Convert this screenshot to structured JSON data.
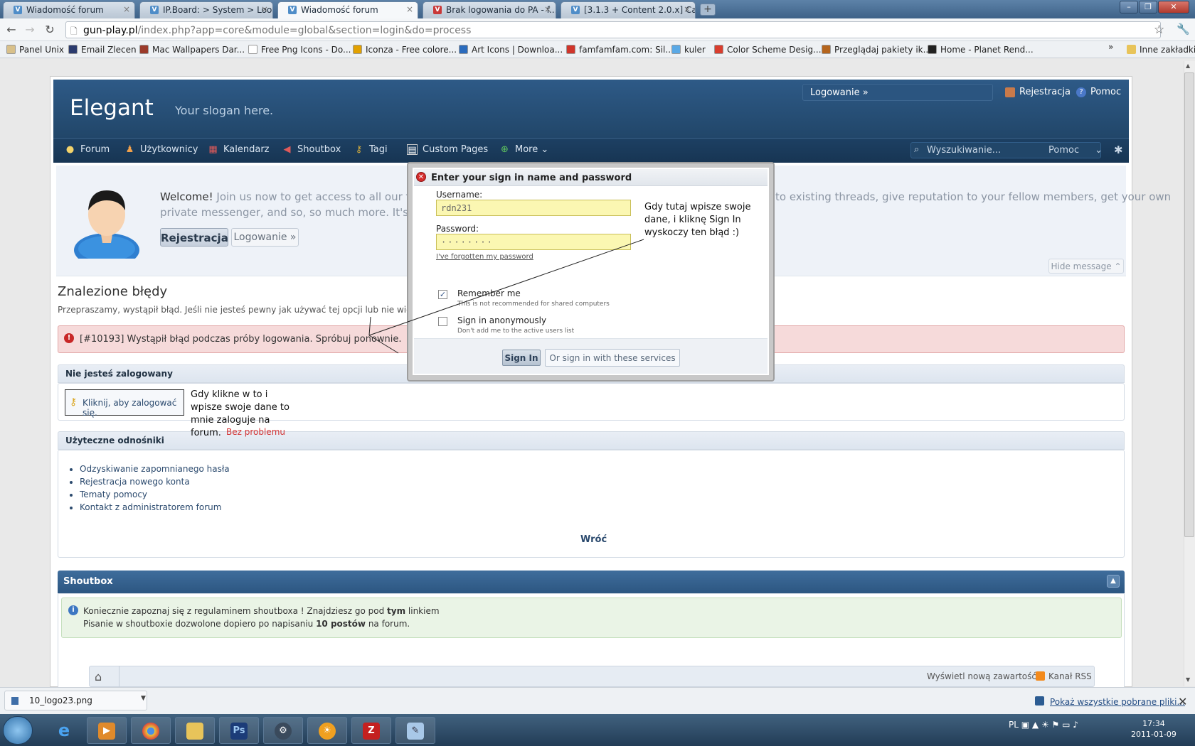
{
  "browser": {
    "tabs": [
      {
        "label": "Wiadomość forum"
      },
      {
        "label": "IP.Board: > System > Loo..."
      },
      {
        "label": "Wiadomość forum"
      },
      {
        "label": "Brak logowania do PA - f..."
      },
      {
        "label": "[3.1.3 + Content 2.0.x] Ca..."
      }
    ],
    "new_tab": "+",
    "url_domain": "gun-play.pl",
    "url_path": "/index.php?app=core&module=global&section=login&do=process",
    "bookmarks": [
      {
        "label": "Panel Unix",
        "color": "#d8c08a"
      },
      {
        "label": "Email Zlecen",
        "color": "#2b3b6e"
      },
      {
        "label": "Mac Wallpapers Dar...",
        "color": "#9b3b2b"
      },
      {
        "label": "Free Png Icons - Do...",
        "color": "#ffffff"
      },
      {
        "label": "Iconza - Free colore...",
        "color": "#e2a100"
      },
      {
        "label": "Art Icons | Downloa...",
        "color": "#2a6bbd"
      },
      {
        "label": "famfamfam.com: Sil...",
        "color": "#d0352b"
      },
      {
        "label": "kuler",
        "color": "#5aa9e6"
      },
      {
        "label": "Color Scheme Desig...",
        "color": "#d93d2e"
      },
      {
        "label": "Przeglądaj pakiety ik...",
        "color": "#b5651d"
      },
      {
        "label": "Home - Planet Rend...",
        "color": "#222222"
      }
    ],
    "other_bookmarks": "Inne zakładki"
  },
  "site": {
    "logo": "Elegant",
    "slogan": "Your slogan here.",
    "login_bar": "Logowanie »",
    "register": "Rejestracja",
    "help": "Pomoc",
    "nav": [
      {
        "label": "Forum",
        "icon": "speech-bubble-icon"
      },
      {
        "label": "Użytkownicy",
        "icon": "users-icon"
      },
      {
        "label": "Kalendarz",
        "icon": "calendar-icon"
      },
      {
        "label": "Shoutbox",
        "icon": "megaphone-icon"
      },
      {
        "label": "Tagi",
        "icon": "key-icon"
      },
      {
        "label": "Custom Pages",
        "icon": "page-icon"
      },
      {
        "label": "More",
        "icon": "plus-icon"
      }
    ],
    "search_placeholder": "Wyszukiwanie...",
    "search_scope": "Pomoc"
  },
  "welcome": {
    "lead": "Welcome!",
    "line1": " Join us now to get access to all our features",
    "line1_end": "to existing threads, give reputation to your fellow members, get your own",
    "line2": "private messenger, and so, so much more. It's also q",
    "register_button": "Rejestracja",
    "login_button": "Logowanie »",
    "hide": "Hide message"
  },
  "errors": {
    "title": "Znalezione błędy",
    "subtitle": "Przepraszamy, wystąpił błąd. Jeśli nie jesteś pewny jak używać tej opcji lub nie wiesz dlacze",
    "message": "[#10193] Wystąpił błąd podczas próby logowania. Spróbuj ponownie."
  },
  "not_logged": {
    "heading": "Nie jesteś zalogowany",
    "link": "Kliknij, aby zalogować się."
  },
  "useful_links": {
    "heading": "Użyteczne odnośniki",
    "items": [
      "Odzyskiwanie zapomnianego hasła",
      "Rejestracja nowego konta",
      "Tematy pomocy",
      "Kontakt z administratorem forum"
    ],
    "back": "Wróć"
  },
  "shoutbox": {
    "heading": "Shoutbox",
    "line1_a": "Koniecznie zapoznaj się z regulaminem shoutboxa ! Znajdziesz go pod ",
    "line1_b": "tym",
    "line1_c": " linkiem",
    "line2_a": "Pisanie w shoutboxie dozwolone dopiero po napisaniu ",
    "line2_b": "10 postów",
    "line2_c": " na forum."
  },
  "footer_bar": {
    "new_content": "Wyświetl nową zawartość",
    "rss": "Kanał RSS"
  },
  "dialog": {
    "title": "Enter your sign in name and password",
    "username_label": "Username:",
    "username_value": "rdn231",
    "password_label": "Password:",
    "password_value": "········",
    "forgot": "I've forgotten my password",
    "remember_label": "Remember me",
    "remember_sub": "This is not recommended for shared computers",
    "remember_checked": true,
    "anon_label": "Sign in anonymously",
    "anon_sub": "Don't add me to the active users list",
    "signin": "Sign In",
    "services": "Or sign in with these services"
  },
  "annotations": {
    "a1": [
      "Gdy tutaj wpisze swoje",
      "dane, i kliknę Sign In",
      "wyskoczy ten błąd :)"
    ],
    "a2": [
      "Gdy klikne w to i",
      "wpisze swoje dane to",
      "mnie zaloguje na",
      "forum."
    ],
    "a3": "Bez problemu"
  },
  "downloads": {
    "file": "10_logo23.png",
    "show_all": "Pokaż wszystkie pobrane pliki..."
  },
  "taskbar": {
    "lang": "PL",
    "time": "17:34",
    "date": "2011-01-09",
    "apps": [
      "ie-icon",
      "media-player-icon",
      "chrome-icon",
      "explorer-icon",
      "photoshop-icon",
      "steam-icon",
      "weather-icon",
      "filezilla-icon",
      "notepad-icon"
    ]
  },
  "colors": {
    "header": "#214669",
    "error_bg": "#f6dada",
    "dialog_input": "#fbf7b2",
    "annotation_red": "#d23232"
  }
}
